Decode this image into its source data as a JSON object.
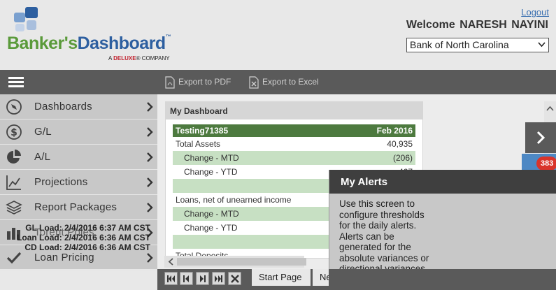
{
  "header": {
    "brand_part1": "Banker's",
    "brand_part2": "Dashboard",
    "brand_tm": "™",
    "tagline_prefix": "A",
    "tagline_brand": "DELUXE",
    "tagline_suffix": "® COMPANY",
    "logout_label": "Logout",
    "welcome_text": "Welcome  NARESH NAYINI",
    "bank_selected": "Bank of North Carolina"
  },
  "toolbar": {
    "export_pdf_label": "Export to PDF",
    "export_excel_label": "Export to Excel"
  },
  "sidebar": {
    "items": [
      {
        "label": "Dashboards",
        "icon": "compass-icon"
      },
      {
        "label": "G/L",
        "icon": "dollar-icon"
      },
      {
        "label": "A/L",
        "icon": "pie-chart-icon"
      },
      {
        "label": "Projections",
        "icon": "line-chart-icon"
      },
      {
        "label": "Report Packages",
        "icon": "layers-icon"
      },
      {
        "label": "Torent Poles",
        "icon": "bar-chart-icon"
      },
      {
        "label": "Loan Pricing",
        "icon": "checkmark-icon"
      }
    ],
    "load_info": [
      "GL Load: 2/4/2016 6:37 AM CST",
      "Loan Load: 2/4/2016 6:36 AM CST",
      "CD Load: 2/4/2016 6:36 AM CST"
    ]
  },
  "dashboard": {
    "panel_title": "My Dashboard",
    "widget_name": "Testing71385",
    "widget_period": "Feb 2016",
    "rows": [
      {
        "label": "Total Assets",
        "value": "40,935",
        "kind": "main"
      },
      {
        "label": "Change - MTD",
        "value": "(206)",
        "kind": "sub"
      },
      {
        "label": "Change - YTD",
        "value": "467",
        "kind": "plain"
      },
      {
        "label": "",
        "value": "",
        "kind": "blank"
      },
      {
        "label": "Loans, net of unearned income",
        "value": "",
        "kind": "main"
      },
      {
        "label": "Change - MTD",
        "value": "",
        "kind": "sub"
      },
      {
        "label": "Change - YTD",
        "value": "",
        "kind": "plain"
      },
      {
        "label": "",
        "value": "",
        "kind": "blank"
      },
      {
        "label": "Total Deposits",
        "value": "",
        "kind": "main"
      }
    ]
  },
  "alerts": {
    "title": "My Alerts",
    "body": "Use this screen to configure thresholds for the daily alerts. Alerts can be generated for the absolute variances or directional variances (upward or downward). Y"
  },
  "notifications": {
    "count": "383"
  },
  "footer": {
    "tab_start": "Start Page",
    "tab_next": "Ne"
  },
  "colors": {
    "brand_green": "#5a9a3a",
    "brand_blue": "#2d5fa0",
    "widget_header": "#4d7a3f",
    "row_highlight": "#c7e0c3",
    "toolbar": "#5a5a5a",
    "badge": "#d9342b"
  }
}
